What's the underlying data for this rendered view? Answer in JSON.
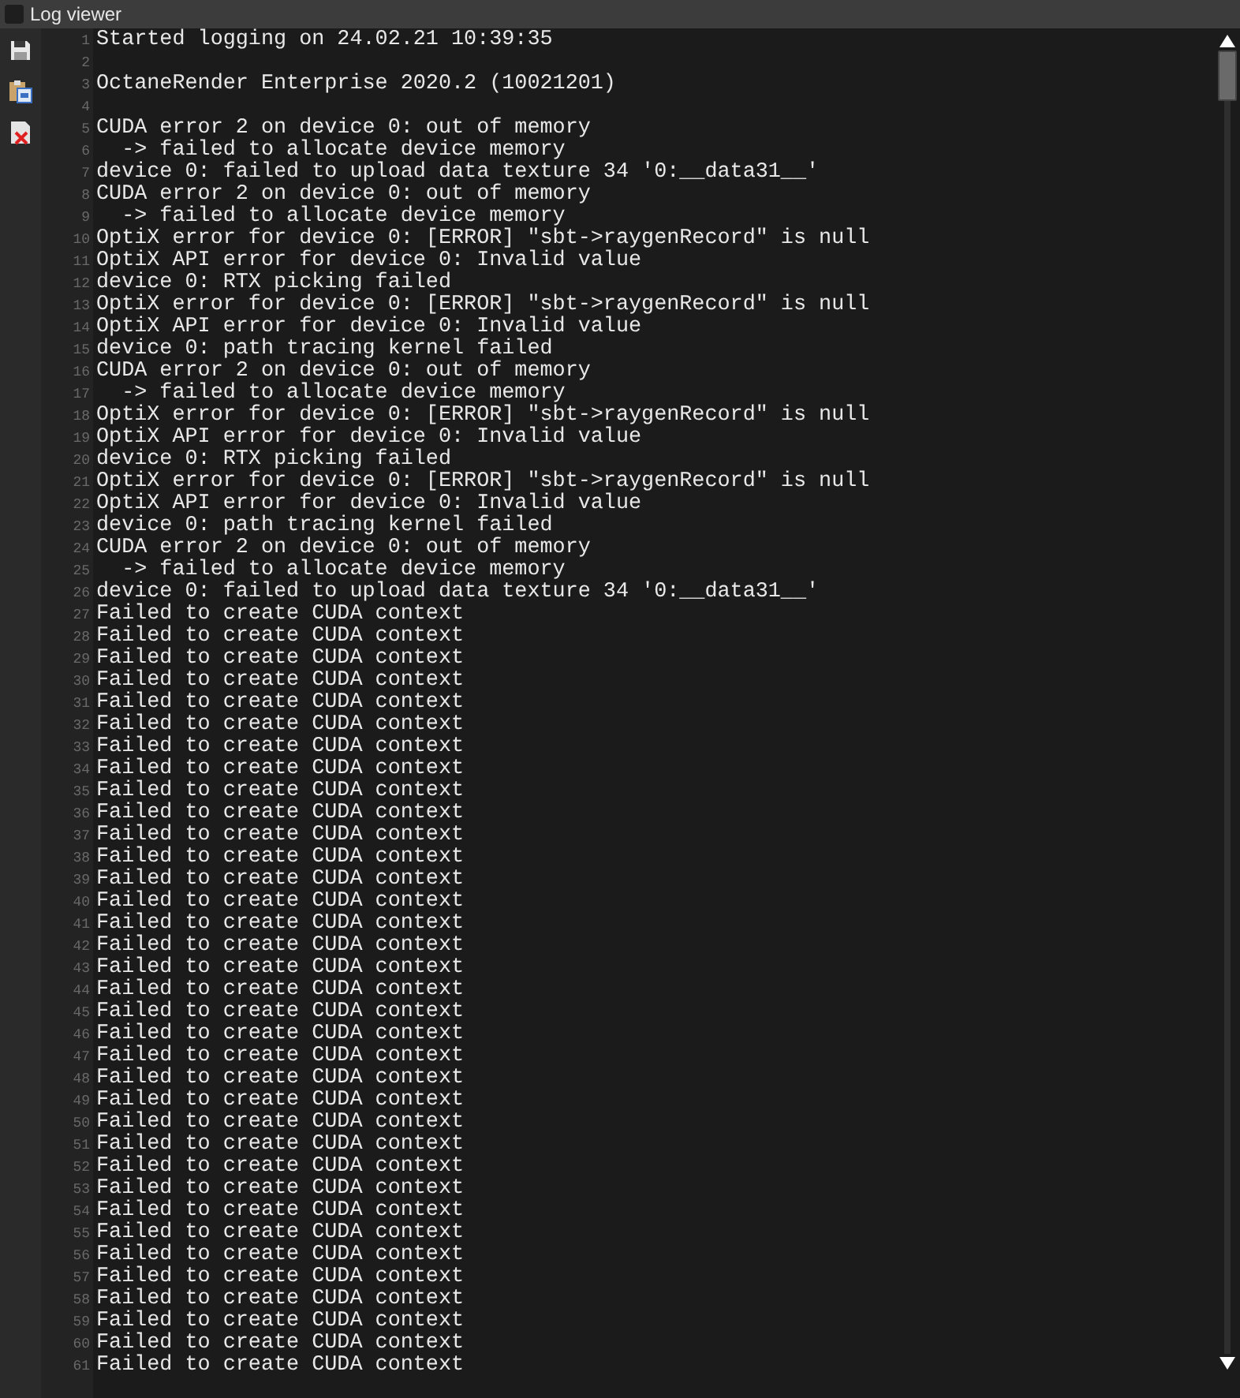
{
  "window": {
    "title": "Log viewer"
  },
  "toolbar": [
    {
      "kind": "save"
    },
    {
      "kind": "paste"
    },
    {
      "kind": "clear"
    }
  ],
  "lines": [
    {
      "number": "1",
      "text": "Started logging on 24.02.21 10:39:35"
    },
    {
      "number": "2"
    },
    {
      "number": "3",
      "text": "OctaneRender Enterprise 2020.2 (10021201)"
    },
    {
      "number": "4"
    },
    {
      "number": "5",
      "text": "CUDA error 2 on device 0: out of memory"
    },
    {
      "number": "6",
      "text": "  -> failed to allocate device memory"
    },
    {
      "number": "7",
      "text": "device 0: failed to upload data texture 34 '0:__data31__'"
    },
    {
      "number": "8",
      "text": "CUDA error 2 on device 0: out of memory"
    },
    {
      "number": "9",
      "text": "  -> failed to allocate device memory"
    },
    {
      "number": "10",
      "text": "OptiX error for device 0: [ERROR] \"sbt->raygenRecord\" is null"
    },
    {
      "number": "11",
      "text": "OptiX API error for device 0: Invalid value"
    },
    {
      "number": "12",
      "text": "device 0: RTX picking failed"
    },
    {
      "number": "13",
      "text": "OptiX error for device 0: [ERROR] \"sbt->raygenRecord\" is null"
    },
    {
      "number": "14",
      "text": "OptiX API error for device 0: Invalid value"
    },
    {
      "number": "15",
      "text": "device 0: path tracing kernel failed"
    },
    {
      "number": "16",
      "text": "CUDA error 2 on device 0: out of memory"
    },
    {
      "number": "17",
      "text": "  -> failed to allocate device memory"
    },
    {
      "number": "18",
      "text": "OptiX error for device 0: [ERROR] \"sbt->raygenRecord\" is null"
    },
    {
      "number": "19",
      "text": "OptiX API error for device 0: Invalid value"
    },
    {
      "number": "20",
      "text": "device 0: RTX picking failed"
    },
    {
      "number": "21",
      "text": "OptiX error for device 0: [ERROR] \"sbt->raygenRecord\" is null"
    },
    {
      "number": "22",
      "text": "OptiX API error for device 0: Invalid value"
    },
    {
      "number": "23",
      "text": "device 0: path tracing kernel failed"
    },
    {
      "number": "24",
      "text": "CUDA error 2 on device 0: out of memory"
    },
    {
      "number": "25",
      "text": "  -> failed to allocate device memory"
    },
    {
      "number": "26",
      "text": "device 0: failed to upload data texture 34 '0:__data31__'"
    },
    {
      "number": "27",
      "text": "Failed to create CUDA context"
    },
    {
      "number": "28",
      "text": "Failed to create CUDA context"
    },
    {
      "number": "29",
      "text": "Failed to create CUDA context"
    },
    {
      "number": "30",
      "text": "Failed to create CUDA context"
    },
    {
      "number": "31",
      "text": "Failed to create CUDA context"
    },
    {
      "number": "32",
      "text": "Failed to create CUDA context"
    },
    {
      "number": "33",
      "text": "Failed to create CUDA context"
    },
    {
      "number": "34",
      "text": "Failed to create CUDA context"
    },
    {
      "number": "35",
      "text": "Failed to create CUDA context"
    },
    {
      "number": "36",
      "text": "Failed to create CUDA context"
    },
    {
      "number": "37",
      "text": "Failed to create CUDA context"
    },
    {
      "number": "38",
      "text": "Failed to create CUDA context"
    },
    {
      "number": "39",
      "text": "Failed to create CUDA context"
    },
    {
      "number": "40",
      "text": "Failed to create CUDA context"
    },
    {
      "number": "41",
      "text": "Failed to create CUDA context"
    },
    {
      "number": "42",
      "text": "Failed to create CUDA context"
    },
    {
      "number": "43",
      "text": "Failed to create CUDA context"
    },
    {
      "number": "44",
      "text": "Failed to create CUDA context"
    },
    {
      "number": "45",
      "text": "Failed to create CUDA context"
    },
    {
      "number": "46",
      "text": "Failed to create CUDA context"
    },
    {
      "number": "47",
      "text": "Failed to create CUDA context"
    },
    {
      "number": "48",
      "text": "Failed to create CUDA context"
    },
    {
      "number": "49",
      "text": "Failed to create CUDA context"
    },
    {
      "number": "50",
      "text": "Failed to create CUDA context"
    },
    {
      "number": "51",
      "text": "Failed to create CUDA context"
    },
    {
      "number": "52",
      "text": "Failed to create CUDA context"
    },
    {
      "number": "53",
      "text": "Failed to create CUDA context"
    },
    {
      "number": "54",
      "text": "Failed to create CUDA context"
    },
    {
      "number": "55",
      "text": "Failed to create CUDA context"
    },
    {
      "number": "56",
      "text": "Failed to create CUDA context"
    },
    {
      "number": "57",
      "text": "Failed to create CUDA context"
    },
    {
      "number": "58",
      "text": "Failed to create CUDA context"
    },
    {
      "number": "59",
      "text": "Failed to create CUDA context"
    },
    {
      "number": "60",
      "text": "Failed to create CUDA context"
    },
    {
      "number": "61",
      "text": "Failed to create CUDA context"
    }
  ]
}
